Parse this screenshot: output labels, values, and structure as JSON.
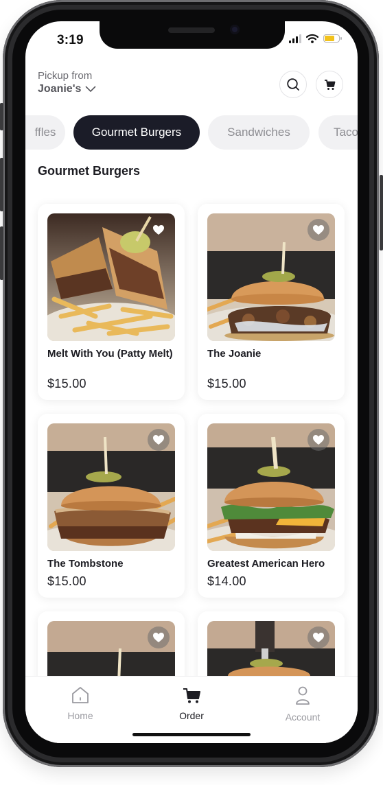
{
  "status_bar": {
    "time": "3:19"
  },
  "header": {
    "pickup_label": "Pickup from",
    "location": "Joanie's",
    "search_icon": "search-icon",
    "cart_icon": "cart-icon"
  },
  "categories": [
    {
      "label": "Waffles",
      "visible_text": "ffles",
      "active": false
    },
    {
      "label": "Gourmet Burgers",
      "active": true
    },
    {
      "label": "Sandwiches",
      "active": false
    },
    {
      "label": "Tacos",
      "visible_text": "Taco",
      "active": false
    }
  ],
  "section_title": "Gourmet Burgers",
  "items": [
    {
      "name": "Melt With You (Patty Melt)",
      "price": "$15.00",
      "favorite_icon": "heart-icon"
    },
    {
      "name": "The Joanie",
      "price": "$15.00",
      "favorite_icon": "heart-icon"
    },
    {
      "name": "The Tombstone",
      "price": "$15.00",
      "favorite_icon": "heart-icon"
    },
    {
      "name": "Greatest American Hero",
      "price": "$14.00",
      "favorite_icon": "heart-icon"
    },
    {
      "name": "",
      "price": "",
      "favorite_icon": "heart-icon"
    },
    {
      "name": "",
      "price": "",
      "favorite_icon": "heart-icon"
    }
  ],
  "tab_bar": {
    "tabs": [
      {
        "label": "Home",
        "icon": "home-icon",
        "active": false
      },
      {
        "label": "Order",
        "icon": "cart-icon",
        "active": true
      },
      {
        "label": "Account",
        "icon": "user-icon",
        "active": false
      }
    ]
  },
  "colors": {
    "accent_dark": "#1b1c28",
    "chip_inactive": "#f1f1f3",
    "battery": "#f2c21c"
  }
}
